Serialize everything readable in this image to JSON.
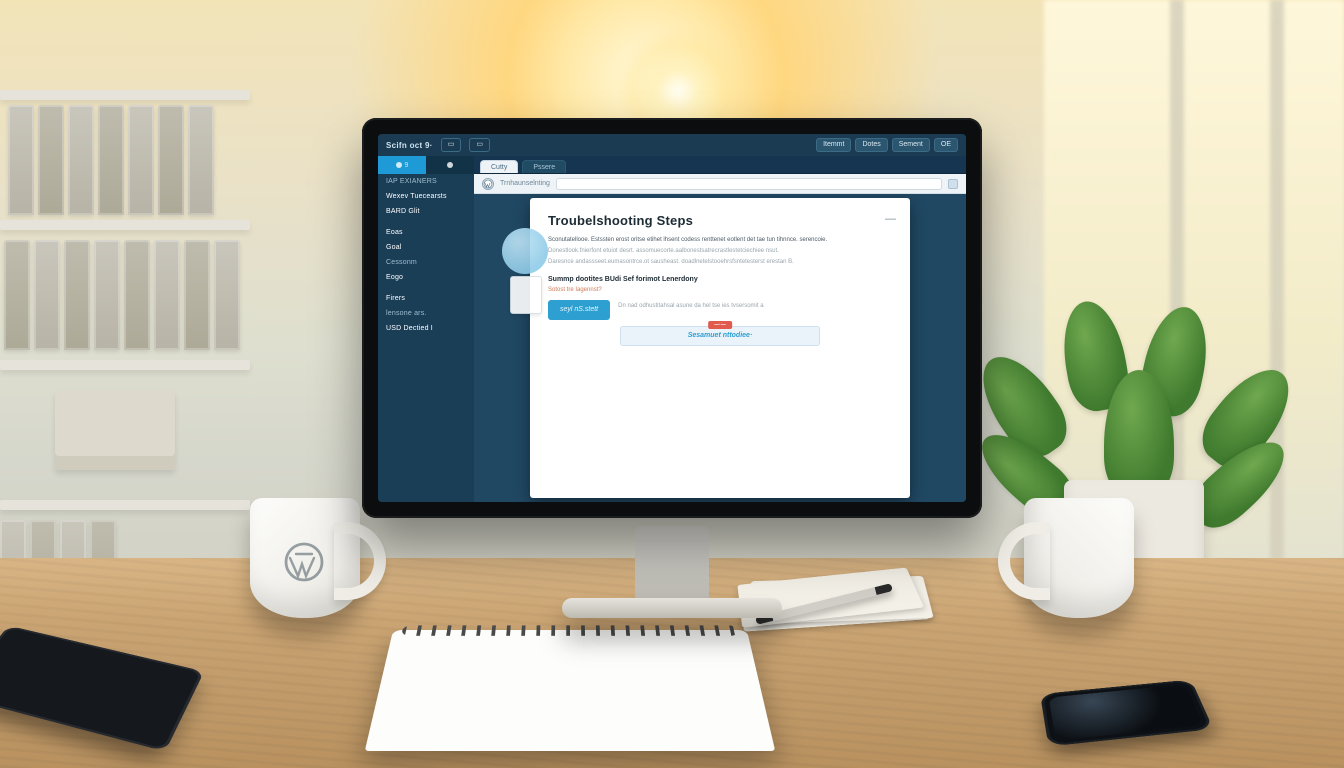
{
  "topbar": {
    "brand": "Scifn oct 9·",
    "chips": [
      "Itemmt",
      "Dotes",
      "Sement",
      "OE"
    ],
    "ghost_chips": [
      "",
      ""
    ]
  },
  "sidebar": {
    "tab_active": "1",
    "tab_num": "9",
    "items": [
      {
        "label": "IAP EXIANERS",
        "cls": "dim"
      },
      {
        "label": "Wexev  Tuecearsts",
        "cls": "bright"
      },
      {
        "label": "BARD Glit",
        "cls": "bright"
      },
      {
        "label": "",
        "cls": "sep"
      },
      {
        "label": "Eoas",
        "cls": "bright"
      },
      {
        "label": "Goal",
        "cls": "bright"
      },
      {
        "label": "Cessonm",
        "cls": "dim"
      },
      {
        "label": "Eogo",
        "cls": "bright"
      },
      {
        "label": "",
        "cls": "sep"
      },
      {
        "label": "Firers",
        "cls": "bright"
      },
      {
        "label": "lensone ars.",
        "cls": "dim"
      },
      {
        "label": "USD Dectied I",
        "cls": "bright"
      }
    ]
  },
  "tabs": {
    "primary": "Cutty",
    "secondary": "Pssere"
  },
  "browser": {
    "crumb": "Trnhaunselnting"
  },
  "article": {
    "title": "Troubelshooting Steps",
    "p1": "Sconutatellooe. Estssten erost oritse etihet lhsent codess renttenet eotlent det tae tun tihnnce. serencoie.",
    "p2": "Donestlook.fnierfont etuiot desrt. assomuecorte.aalbonestsatrecrastlestetciechiee nsut.",
    "p3": "Daresnce andassseet.eumasontrce.ot sausheast. doadlnetelstooehrsfsntetesterst erestan B.",
    "subhead": "Summp dootites BUdi Sef forimot Lenerdony",
    "link": "Sotost tre  Iagennst?",
    "cta": "seyl nS.stett",
    "footline": "Dn nad odhustitahsal asune da hel tse ies tvsersomit a",
    "banner": "Sesamuet nttodiee·",
    "banner_warn": "—·—"
  }
}
